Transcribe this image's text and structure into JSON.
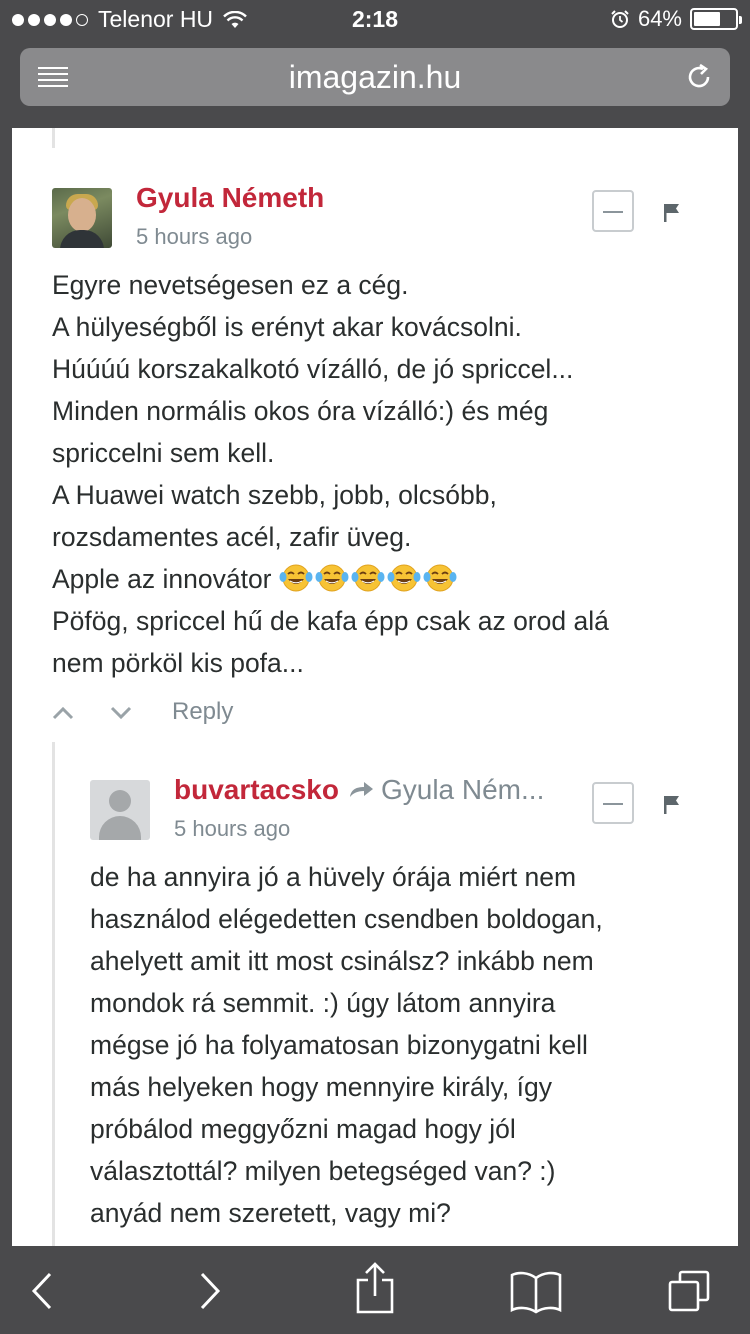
{
  "status_bar": {
    "carrier": "Telenor HU",
    "time": "2:18",
    "battery_percent_label": "64%",
    "battery_level": 0.64,
    "signal_bars": 4
  },
  "browser": {
    "url": "imagazin.hu",
    "icons": [
      "reader-icon",
      "reload-icon"
    ]
  },
  "comments": [
    {
      "author": "Gyula Németh",
      "time": "5 hours ago",
      "lines": [
        "Egyre nevetségesen ez a cég.",
        "A hülyeségből is erényt akar kovácsolni.",
        "Húúúú korszakalkotó vízálló, de jó spriccel...",
        "Minden normális okos óra vízálló:) és még",
        "spriccelni sem kell.",
        "A Huawei watch szebb, jobb, olcsóbb,",
        "rozsdamentes acél, zafir üveg.",
        "Apple az innovátor",
        "Pöfög, spriccel hű de kafa épp csak az orod alá",
        "nem pörköl kis pofa..."
      ],
      "emoji_count": 5,
      "reply_label": "Reply"
    },
    {
      "author": "buvartacsko",
      "reply_to": "Gyula Ném...",
      "time": "5 hours ago",
      "lines": [
        "de ha annyira jó a hüvely órája miért nem",
        "használod elégedetten csendben boldogan,",
        "ahelyett amit itt most csinálsz? inkább nem",
        "mondok rá semmit. :) úgy látom annyira",
        "mégse jó ha folyamatosan bizonygatni kell",
        "más helyeken hogy mennyire király, így",
        "próbálod meggyőzni magad hogy jól",
        "választottál? milyen betegséged van? :)",
        "anyád nem szeretett, vagy mi?"
      ]
    }
  ],
  "colors": {
    "author": "#c2273a",
    "meta": "#7f8a91",
    "text": "#2a2e2e",
    "chrome": "#4a4a4c"
  },
  "toolbar_icons": [
    "back-icon",
    "forward-icon",
    "share-icon",
    "bookmarks-icon",
    "tabs-icon"
  ]
}
